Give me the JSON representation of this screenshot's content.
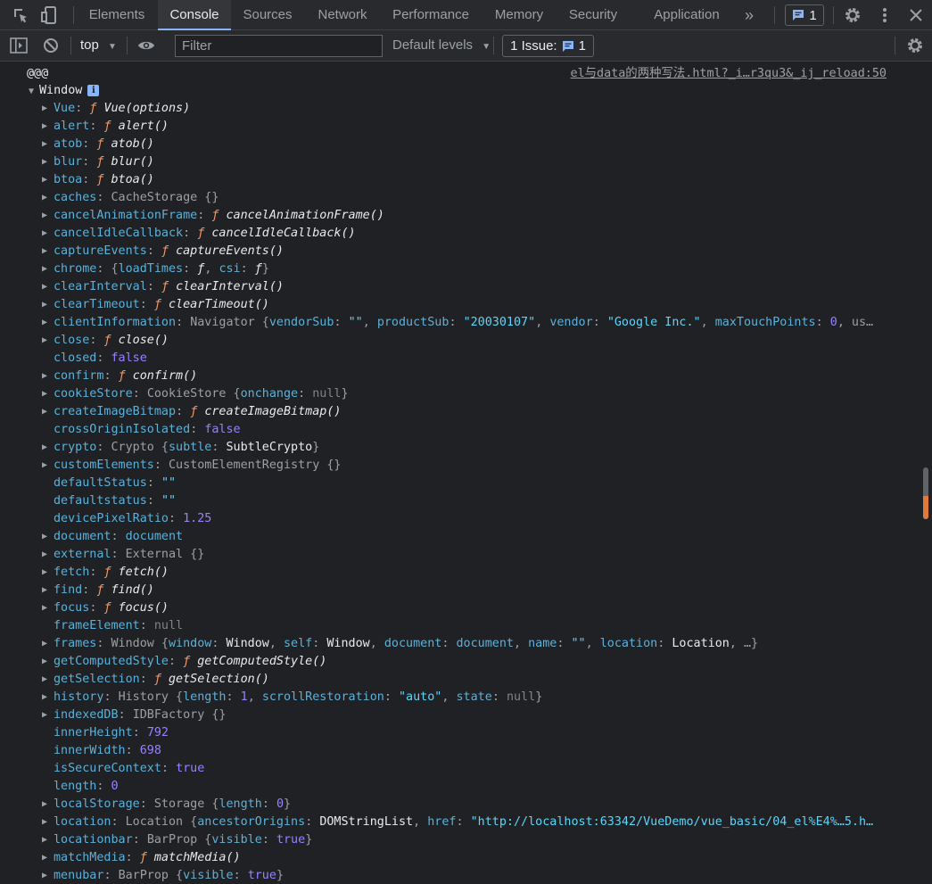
{
  "tabs": [
    {
      "label": "Elements"
    },
    {
      "label": "Console"
    },
    {
      "label": "Sources"
    },
    {
      "label": "Network"
    },
    {
      "label": "Performance"
    },
    {
      "label": "Memory"
    },
    {
      "label": "Security"
    },
    {
      "label": "Application"
    }
  ],
  "more_tabs_glyph": "»",
  "issue_chip_count": "1",
  "toolbar": {
    "context": "top",
    "filter_placeholder": "Filter",
    "levels": "Default levels",
    "issues_label": "1 Issue:",
    "issues_count": "1"
  },
  "log": {
    "message": "@@@",
    "source": "el与data的两种写法.html?_i…r3qu3&_ij_reload:50",
    "window_label": "Window"
  },
  "properties": [
    {
      "key": "Vue",
      "expandable": true,
      "parts": [
        [
          "fn-f",
          "ƒ "
        ],
        [
          "fn",
          "Vue(options)"
        ]
      ]
    },
    {
      "key": "alert",
      "expandable": true,
      "parts": [
        [
          "fn-f",
          "ƒ "
        ],
        [
          "fn",
          "alert()"
        ]
      ]
    },
    {
      "key": "atob",
      "expandable": true,
      "parts": [
        [
          "fn-f",
          "ƒ "
        ],
        [
          "fn",
          "atob()"
        ]
      ]
    },
    {
      "key": "blur",
      "expandable": true,
      "parts": [
        [
          "fn-f",
          "ƒ "
        ],
        [
          "fn",
          "blur()"
        ]
      ]
    },
    {
      "key": "btoa",
      "expandable": true,
      "parts": [
        [
          "fn-f",
          "ƒ "
        ],
        [
          "fn",
          "btoa()"
        ]
      ]
    },
    {
      "key": "caches",
      "expandable": true,
      "parts": [
        [
          "obj",
          "CacheStorage {}"
        ]
      ]
    },
    {
      "key": "cancelAnimationFrame",
      "expandable": true,
      "parts": [
        [
          "fn-f",
          "ƒ "
        ],
        [
          "fn",
          "cancelAnimationFrame()"
        ]
      ]
    },
    {
      "key": "cancelIdleCallback",
      "expandable": true,
      "parts": [
        [
          "fn-f",
          "ƒ "
        ],
        [
          "fn",
          "cancelIdleCallback()"
        ]
      ]
    },
    {
      "key": "captureEvents",
      "expandable": true,
      "parts": [
        [
          "fn-f",
          "ƒ "
        ],
        [
          "fn",
          "captureEvents()"
        ]
      ]
    },
    {
      "key": "chrome",
      "expandable": true,
      "parts": [
        [
          "obj",
          "{"
        ],
        [
          "k",
          "loadTimes"
        ],
        [
          "p",
          ": "
        ],
        [
          "fn",
          "ƒ"
        ],
        [
          "obj",
          ", "
        ],
        [
          "k",
          "csi"
        ],
        [
          "p",
          ": "
        ],
        [
          "fn",
          "ƒ"
        ],
        [
          "obj",
          "}"
        ]
      ]
    },
    {
      "key": "clearInterval",
      "expandable": true,
      "parts": [
        [
          "fn-f",
          "ƒ "
        ],
        [
          "fn",
          "clearInterval()"
        ]
      ]
    },
    {
      "key": "clearTimeout",
      "expandable": true,
      "parts": [
        [
          "fn-f",
          "ƒ "
        ],
        [
          "fn",
          "clearTimeout()"
        ]
      ]
    },
    {
      "key": "clientInformation",
      "expandable": true,
      "parts": [
        [
          "obj",
          "Navigator {"
        ],
        [
          "k",
          "vendorSub"
        ],
        [
          "p",
          ": "
        ],
        [
          "str",
          "\"\""
        ],
        [
          "obj",
          ", "
        ],
        [
          "k",
          "productSub"
        ],
        [
          "p",
          ": "
        ],
        [
          "str",
          "\"20030107\""
        ],
        [
          "obj",
          ", "
        ],
        [
          "k",
          "vendor"
        ],
        [
          "p",
          ": "
        ],
        [
          "str",
          "\"Google Inc.\""
        ],
        [
          "obj",
          ", "
        ],
        [
          "k",
          "maxTouchPoints"
        ],
        [
          "p",
          ": "
        ],
        [
          "num",
          "0"
        ],
        [
          "obj",
          ", us…"
        ]
      ]
    },
    {
      "key": "close",
      "expandable": true,
      "parts": [
        [
          "fn-f",
          "ƒ "
        ],
        [
          "fn",
          "close()"
        ]
      ]
    },
    {
      "key": "closed",
      "expandable": false,
      "parts": [
        [
          "bool",
          "false"
        ]
      ]
    },
    {
      "key": "confirm",
      "expandable": true,
      "parts": [
        [
          "fn-f",
          "ƒ "
        ],
        [
          "fn",
          "confirm()"
        ]
      ]
    },
    {
      "key": "cookieStore",
      "expandable": true,
      "parts": [
        [
          "obj",
          "CookieStore {"
        ],
        [
          "k",
          "onchange"
        ],
        [
          "p",
          ": "
        ],
        [
          "nul",
          "null"
        ],
        [
          "obj",
          "}"
        ]
      ]
    },
    {
      "key": "createImageBitmap",
      "expandable": true,
      "parts": [
        [
          "fn-f",
          "ƒ "
        ],
        [
          "fn",
          "createImageBitmap()"
        ]
      ]
    },
    {
      "key": "crossOriginIsolated",
      "expandable": false,
      "parts": [
        [
          "bool",
          "false"
        ]
      ]
    },
    {
      "key": "crypto",
      "expandable": true,
      "parts": [
        [
          "obj",
          "Crypto {"
        ],
        [
          "k",
          "subtle"
        ],
        [
          "p",
          ": "
        ],
        [
          "plain",
          "SubtleCrypto"
        ],
        [
          "obj",
          "}"
        ]
      ]
    },
    {
      "key": "customElements",
      "expandable": true,
      "parts": [
        [
          "obj",
          "CustomElementRegistry {}"
        ]
      ]
    },
    {
      "key": "defaultStatus",
      "expandable": false,
      "parts": [
        [
          "str",
          "\"\""
        ]
      ]
    },
    {
      "key": "defaultstatus",
      "expandable": false,
      "parts": [
        [
          "str",
          "\"\""
        ]
      ]
    },
    {
      "key": "devicePixelRatio",
      "expandable": false,
      "parts": [
        [
          "num",
          "1.25"
        ]
      ]
    },
    {
      "key": "document",
      "expandable": true,
      "parts": [
        [
          "docv",
          "document"
        ]
      ]
    },
    {
      "key": "external",
      "expandable": true,
      "parts": [
        [
          "obj",
          "External {}"
        ]
      ]
    },
    {
      "key": "fetch",
      "expandable": true,
      "parts": [
        [
          "fn-f",
          "ƒ "
        ],
        [
          "fn",
          "fetch()"
        ]
      ]
    },
    {
      "key": "find",
      "expandable": true,
      "parts": [
        [
          "fn-f",
          "ƒ "
        ],
        [
          "fn",
          "find()"
        ]
      ]
    },
    {
      "key": "focus",
      "expandable": true,
      "parts": [
        [
          "fn-f",
          "ƒ "
        ],
        [
          "fn",
          "focus()"
        ]
      ]
    },
    {
      "key": "frameElement",
      "expandable": false,
      "parts": [
        [
          "nul",
          "null"
        ]
      ]
    },
    {
      "key": "frames",
      "expandable": true,
      "parts": [
        [
          "obj",
          "Window {"
        ],
        [
          "k",
          "window"
        ],
        [
          "p",
          ": "
        ],
        [
          "plain",
          "Window"
        ],
        [
          "obj",
          ", "
        ],
        [
          "k",
          "self"
        ],
        [
          "p",
          ": "
        ],
        [
          "plain",
          "Window"
        ],
        [
          "obj",
          ", "
        ],
        [
          "k",
          "document"
        ],
        [
          "p",
          ": "
        ],
        [
          "docv",
          "document"
        ],
        [
          "obj",
          ", "
        ],
        [
          "k",
          "name"
        ],
        [
          "p",
          ": "
        ],
        [
          "str",
          "\"\""
        ],
        [
          "obj",
          ", "
        ],
        [
          "k",
          "location"
        ],
        [
          "p",
          ": "
        ],
        [
          "plain",
          "Location"
        ],
        [
          "obj",
          ", …}"
        ]
      ]
    },
    {
      "key": "getComputedStyle",
      "expandable": true,
      "parts": [
        [
          "fn-f",
          "ƒ "
        ],
        [
          "fn",
          "getComputedStyle()"
        ]
      ]
    },
    {
      "key": "getSelection",
      "expandable": true,
      "parts": [
        [
          "fn-f",
          "ƒ "
        ],
        [
          "fn",
          "getSelection()"
        ]
      ]
    },
    {
      "key": "history",
      "expandable": true,
      "parts": [
        [
          "obj",
          "History {"
        ],
        [
          "k",
          "length"
        ],
        [
          "p",
          ": "
        ],
        [
          "num",
          "1"
        ],
        [
          "obj",
          ", "
        ],
        [
          "k",
          "scrollRestoration"
        ],
        [
          "p",
          ": "
        ],
        [
          "str",
          "\"auto\""
        ],
        [
          "obj",
          ", "
        ],
        [
          "k",
          "state"
        ],
        [
          "p",
          ": "
        ],
        [
          "nul",
          "null"
        ],
        [
          "obj",
          "}"
        ]
      ]
    },
    {
      "key": "indexedDB",
      "expandable": true,
      "parts": [
        [
          "obj",
          "IDBFactory {}"
        ]
      ]
    },
    {
      "key": "innerHeight",
      "expandable": false,
      "parts": [
        [
          "num",
          "792"
        ]
      ]
    },
    {
      "key": "innerWidth",
      "expandable": false,
      "parts": [
        [
          "num",
          "698"
        ]
      ]
    },
    {
      "key": "isSecureContext",
      "expandable": false,
      "parts": [
        [
          "bool",
          "true"
        ]
      ]
    },
    {
      "key": "length",
      "expandable": false,
      "parts": [
        [
          "num",
          "0"
        ]
      ]
    },
    {
      "key": "localStorage",
      "expandable": true,
      "parts": [
        [
          "obj",
          "Storage {"
        ],
        [
          "k",
          "length"
        ],
        [
          "p",
          ": "
        ],
        [
          "num",
          "0"
        ],
        [
          "obj",
          "}"
        ]
      ]
    },
    {
      "key": "location",
      "expandable": true,
      "parts": [
        [
          "obj",
          "Location {"
        ],
        [
          "k",
          "ancestorOrigins"
        ],
        [
          "p",
          ": "
        ],
        [
          "plain",
          "DOMStringList"
        ],
        [
          "obj",
          ", "
        ],
        [
          "k",
          "href"
        ],
        [
          "p",
          ": "
        ],
        [
          "str",
          "\"http://localhost:63342/VueDemo/vue_basic/04_el%E4%…5.h…"
        ]
      ]
    },
    {
      "key": "locationbar",
      "expandable": true,
      "parts": [
        [
          "obj",
          "BarProp {"
        ],
        [
          "k",
          "visible"
        ],
        [
          "p",
          ": "
        ],
        [
          "bool",
          "true"
        ],
        [
          "obj",
          "}"
        ]
      ]
    },
    {
      "key": "matchMedia",
      "expandable": true,
      "parts": [
        [
          "fn-f",
          "ƒ "
        ],
        [
          "fn",
          "matchMedia()"
        ]
      ]
    },
    {
      "key": "menubar",
      "expandable": true,
      "parts": [
        [
          "obj",
          "BarProp {"
        ],
        [
          "k",
          "visible"
        ],
        [
          "p",
          ": "
        ],
        [
          "bool",
          "true"
        ],
        [
          "obj",
          "}"
        ]
      ]
    }
  ]
}
